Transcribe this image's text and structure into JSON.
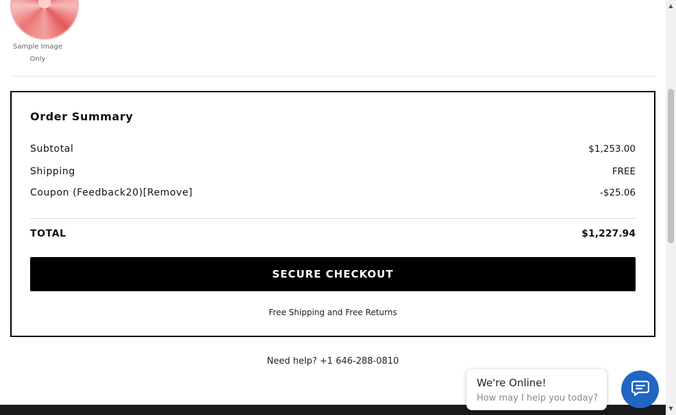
{
  "product": {
    "thumbnail_caption": "Sample Image Only"
  },
  "order_summary": {
    "title": "Order Summary",
    "subtotal_label": "Subtotal",
    "subtotal_value": "$1,253.00",
    "shipping_label": "Shipping",
    "shipping_value": "FREE",
    "coupon_label": "Coupon (Feedback20)",
    "coupon_remove": "[Remove]",
    "coupon_value": "-$25.06",
    "total_label": "TOTAL",
    "total_value": "$1,227.94",
    "checkout_label": "SECURE CHECKOUT",
    "free_shipping_note": "Free Shipping and Free Returns"
  },
  "help": {
    "text": "Need help? +1 646-288-0810"
  },
  "chat": {
    "title": "We're Online!",
    "subtitle": "How may I help you today?",
    "icon": "chat-icon",
    "color": "#1f67c2"
  },
  "scrollbar": {
    "up_icon": "scroll-up-arrow-icon",
    "down_icon": "scroll-down-arrow-icon"
  }
}
